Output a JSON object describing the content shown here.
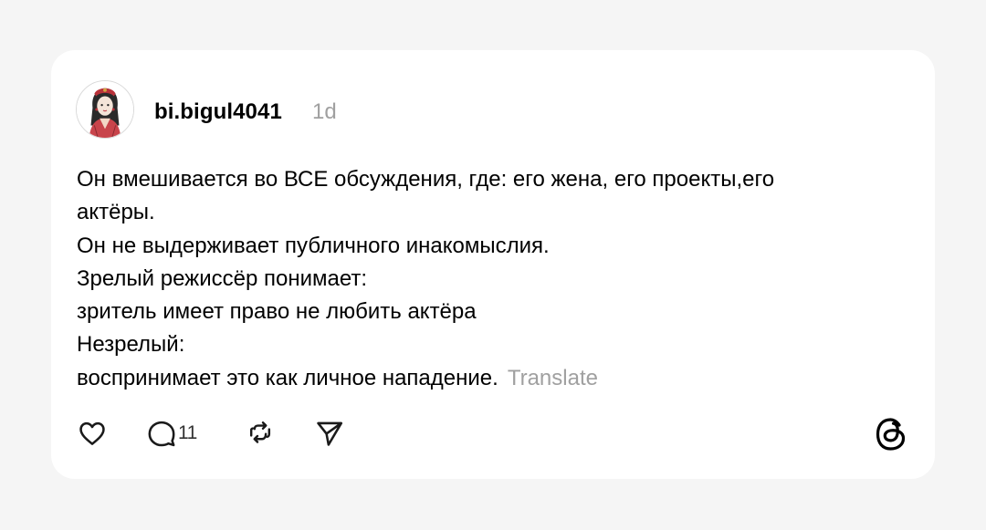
{
  "post": {
    "username": "bi.bigul4041",
    "time": "1d",
    "lines": [
      "Он вмешивается во ВСЕ обсуждения, где: его жена, его проекты,его",
      "актёры.",
      "Он не выдерживает публичного инакомыслия.",
      "Зрелый режиссёр понимает:",
      "зритель имеет право не любить актёра",
      "Незрелый:",
      "воспринимает это как личное нападение."
    ],
    "translate_label": "Translate"
  },
  "actions": {
    "like_icon": "heart-icon",
    "comment_icon": "speech-bubble-icon",
    "comment_count": "11",
    "repost_icon": "repost-icon",
    "share_icon": "paper-plane-icon"
  },
  "brand": {
    "logo_icon": "threads-logo-icon"
  },
  "colors": {
    "background": "#f5f5f5",
    "card": "#ffffff",
    "muted_text": "#a0a0a0",
    "text": "#000000"
  }
}
